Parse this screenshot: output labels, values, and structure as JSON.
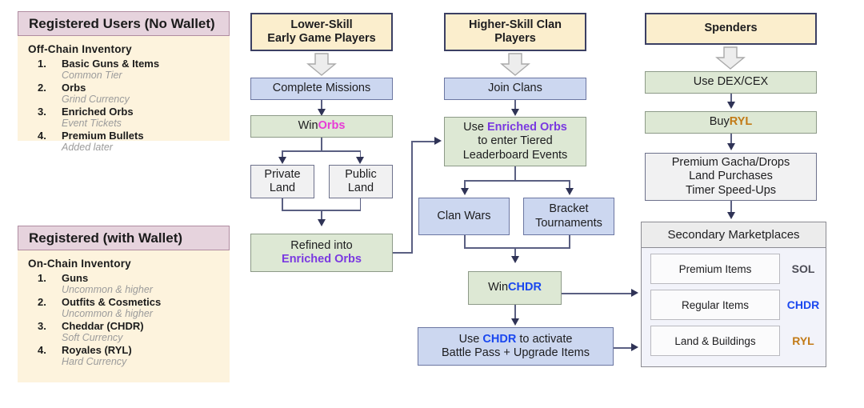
{
  "panels": [
    {
      "title": "Registered Users (No Wallet)",
      "subtitle": "Off-Chain Inventory",
      "items": [
        {
          "num": "1.",
          "name": "Basic Guns & Items",
          "desc": "Common Tier"
        },
        {
          "num": "2.",
          "name": "Orbs",
          "desc": "Grind Currency"
        },
        {
          "num": "3.",
          "name": "Enriched Orbs",
          "desc": "Event Tickets"
        },
        {
          "num": "4.",
          "name": "Premium Bullets",
          "desc": "Added later"
        }
      ]
    },
    {
      "title": "Registered (with Wallet)",
      "subtitle": "On-Chain Inventory",
      "items": [
        {
          "num": "1.",
          "name": "Guns",
          "desc": "Uncommon & higher"
        },
        {
          "num": "2.",
          "name": "Outfits & Cosmetics",
          "desc": "Uncommon & higher"
        },
        {
          "num": "3.",
          "name": "Cheddar (CHDR)",
          "desc": "Soft Currency"
        },
        {
          "num": "4.",
          "name": "Royales (RYL)",
          "desc": "Hard Currency"
        }
      ]
    }
  ],
  "flow": {
    "actors": {
      "lower_skill": "Lower-Skill\nEarly Game Players",
      "lower_skill_l1": "Lower-Skill",
      "lower_skill_l2": "Early Game Players",
      "higher_skill_l1": "Higher-Skill Clan",
      "higher_skill_l2": "Players",
      "spenders": "Spenders"
    },
    "col_low": {
      "complete_missions": "Complete Missions",
      "win_prefix": "Win ",
      "win_token": "Orbs",
      "private_land_l1": "Private",
      "private_land_l2": "Land",
      "public_land_l1": "Public",
      "public_land_l2": "Land",
      "refined_l1": "Refined into",
      "refined_token": "Enriched Orbs"
    },
    "col_high": {
      "join_clans": "Join Clans",
      "use_enriched_pre": "Use ",
      "use_enriched_token": "Enriched Orbs",
      "use_enriched_l2": "to enter Tiered",
      "use_enriched_l3": "Leaderboard Events",
      "clan_wars": "Clan Wars",
      "bracket_l1": "Bracket",
      "bracket_l2": "Tournaments",
      "win_prefix": "Win ",
      "win_token": "CHDR",
      "use_chdr_pre": "Use ",
      "use_chdr_token": "CHDR",
      "use_chdr_post": " to activate",
      "use_chdr_l2": "Battle Pass + Upgrade Items"
    },
    "col_spend": {
      "use_dex_cex": "Use DEX/CEX",
      "buy_prefix": "Buy ",
      "buy_token": "RYL",
      "premium_l1": "Premium Gacha/Drops",
      "premium_l2": "Land Purchases",
      "premium_l3": "Timer Speed-Ups"
    },
    "marketplace": {
      "title": "Secondary Marketplaces",
      "rows": [
        {
          "label": "Premium Items",
          "token": "SOL"
        },
        {
          "label": "Regular Items",
          "token": "CHDR"
        },
        {
          "label": "Land & Buildings",
          "token": "RYL"
        }
      ]
    }
  },
  "colors": {
    "orbs": "#e83bd6",
    "enriched_orbs": "#7a39e0",
    "chdr": "#1a47ef",
    "ryl": "#c27a16",
    "sol": "#4c4c56",
    "actor_fill": "#fbeecd",
    "blue_fill": "#ccd7f0",
    "green_fill": "#dde8d4",
    "panel_head": "#e6d3dd",
    "panel_body": "#fdf3dd",
    "line": "#5a5f82"
  }
}
